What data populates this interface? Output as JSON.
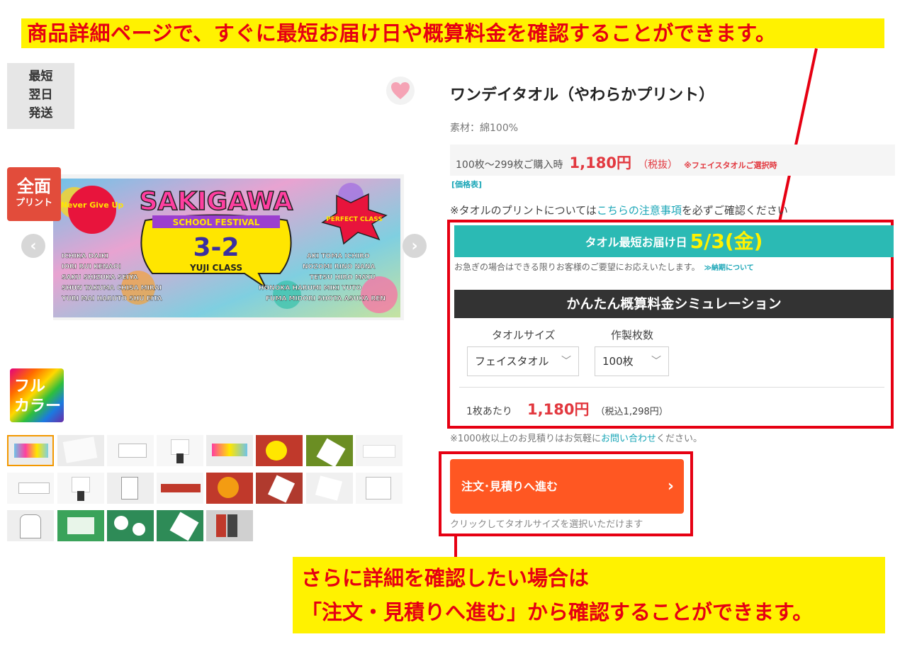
{
  "callouts": {
    "top": "商品詳細ページで、すぐに最短お届け日や概算料金を確認することができます。",
    "bottom_line1": "さらに詳細を確認したい場合は",
    "bottom_line2": "「注文・見積りへ進む」から確認することができます。"
  },
  "badges": {
    "shortest": [
      "最短",
      "翌日",
      "発送"
    ],
    "print_big": "全面",
    "print_small": "プリント",
    "color_line1": "フル",
    "color_line2": "カラー"
  },
  "banner": {
    "never_give_up": "Never Give Up",
    "title": "SAKIGAWA",
    "subtitle": "SCHOOL FESTIVAL",
    "class_number": "3-2",
    "class_name": "YUJI CLASS",
    "perfect_class": "PERFECT CLASS",
    "names_left": [
      "ICHIKA DAIKI",
      "IORI RUI KENAOI",
      "SAKU SHIZUKA SEIYA",
      "SHUN TAKUMA CHISA MIRAI",
      "YURI MAI HARUTO SHU EITA"
    ],
    "names_right": [
      "AKI TOMA ICHIRO",
      "NOZOMI RINO NANA",
      "TETSU HIRO MAYU",
      "HONOKA HARUMI MIKI YUTO",
      "FUMA MIDORI SHOTA ASUKA REN"
    ]
  },
  "product": {
    "title": "ワンデイタオル（やわらかプリント）",
    "material": "素材：綿100%",
    "price_prefix": "100枚〜299枚ご購入時",
    "price": "1,180円",
    "price_tax": "（税抜）",
    "price_note": "※フェイスタオルご選択時",
    "price_table_link": "[価格表]",
    "print_note_pre": "※タオルのプリントについては",
    "print_note_link": "こちらの注意事項",
    "print_note_post": "を必ずご確認ください"
  },
  "delivery": {
    "label": "タオル最短お届け日",
    "date": "5/3(金)",
    "note": "お急ぎの場合はできる限りお客様のご要望にお応えいたします。",
    "note_link": "≫納期について"
  },
  "simulation": {
    "title": "かんたん概算料金シミュレーション",
    "size_label": "タオルサイズ",
    "size_value": "フェイスタオル",
    "qty_label": "作製枚数",
    "qty_value": "100枚",
    "unit_label": "1枚あたり",
    "unit_price": "1,180円",
    "unit_tax": "（税込1,298円）"
  },
  "bulk_note_pre": "※1000枚以上のお見積りはお気軽に",
  "bulk_note_link": "お問い合わせ",
  "bulk_note_post": "ください。",
  "order": {
    "button_label": "注文･見積りへ進む",
    "hint": "クリックしてタオルサイズを選択いただけます"
  },
  "icons": {
    "heart": "heart-icon",
    "chevron_left": "chevron-left-icon",
    "chevron_right": "chevron-right-icon",
    "chevron_down": "chevron-down-icon"
  },
  "colors": {
    "callout_bg": "#fff200",
    "callout_text": "#e60012",
    "price_red": "#e2383f",
    "delivery_teal": "#2bbab4",
    "order_orange": "#ff5722",
    "link_teal": "#1aa6b7"
  }
}
